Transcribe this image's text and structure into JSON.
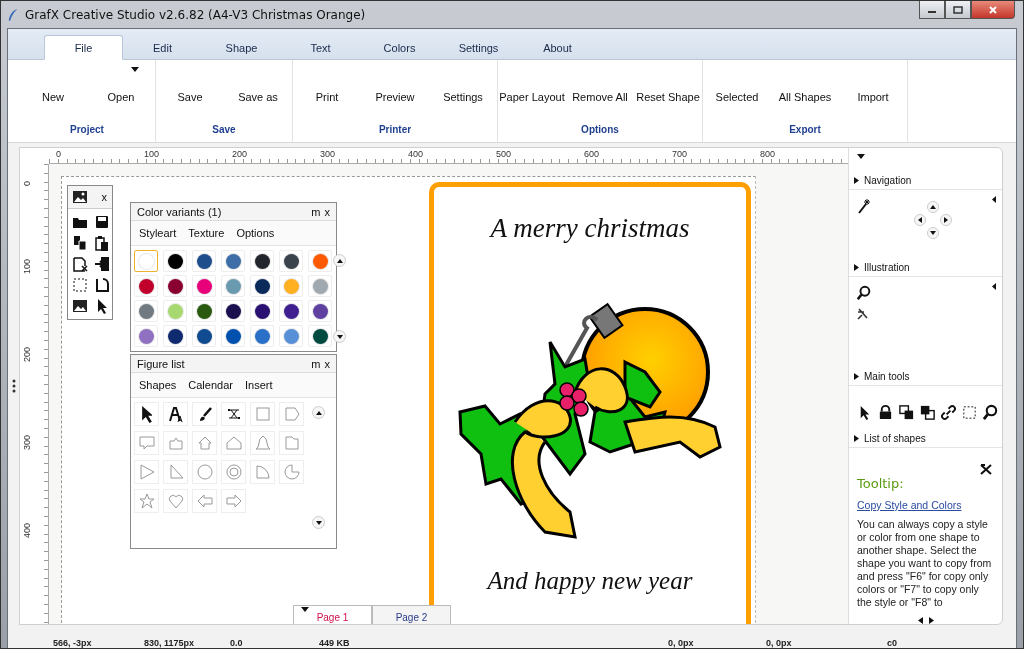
{
  "window": {
    "title": "GrafX Creative Studio v2.6.82 (A4-V3 Christmas Orange)"
  },
  "tabs": [
    {
      "label": "File",
      "selected": true
    },
    {
      "label": "Edit",
      "selected": false
    },
    {
      "label": "Shape",
      "selected": false
    },
    {
      "label": "Text",
      "selected": false
    },
    {
      "label": "Colors",
      "selected": false
    },
    {
      "label": "Settings",
      "selected": false
    },
    {
      "label": "About",
      "selected": false
    }
  ],
  "ribbon": {
    "groups": [
      {
        "label": "Project",
        "buttons": [
          {
            "label": "New",
            "has_menu": false
          },
          {
            "label": "Open",
            "has_menu": true
          }
        ]
      },
      {
        "label": "Save",
        "buttons": [
          {
            "label": "Save",
            "has_menu": false
          },
          {
            "label": "Save as",
            "has_menu": false
          }
        ]
      },
      {
        "label": "Printer",
        "buttons": [
          {
            "label": "Print",
            "has_menu": false
          },
          {
            "label": "Preview",
            "has_menu": false
          },
          {
            "label": "Settings",
            "has_menu": false
          }
        ]
      },
      {
        "label": "Options",
        "buttons": [
          {
            "label": "Paper Layout",
            "has_menu": false
          },
          {
            "label": "Remove All",
            "has_menu": false
          },
          {
            "label": "Reset Shape",
            "has_menu": false
          }
        ]
      },
      {
        "label": "Export",
        "buttons": [
          {
            "label": "Selected",
            "has_menu": false
          },
          {
            "label": "All Shapes",
            "has_menu": false
          },
          {
            "label": "Import",
            "has_menu": false
          }
        ]
      }
    ]
  },
  "rulers": {
    "horizontal": [
      "0",
      "100",
      "200",
      "300",
      "400",
      "500",
      "600",
      "700",
      "800"
    ],
    "vertical": [
      "0",
      "100",
      "200",
      "300",
      "400"
    ]
  },
  "toolbox": {
    "close": "x"
  },
  "color_panel": {
    "title": "Color variants (1)",
    "controls": [
      "m",
      "x"
    ],
    "tabs": [
      "Styleart",
      "Texture",
      "Options"
    ],
    "swatches": [
      {
        "color": "#ffffff",
        "selected": true
      },
      {
        "color": "#000000",
        "selected": false
      },
      {
        "color": "#1e4e8c",
        "selected": false
      },
      {
        "color": "#3d6ea8",
        "selected": false
      },
      {
        "color": "#22262c",
        "selected": false
      },
      {
        "color": "#3a424c",
        "selected": false
      },
      {
        "color": "#ff5a00",
        "selected": false
      },
      {
        "color": "#c0002a",
        "selected": false
      },
      {
        "color": "#8a0030",
        "selected": false
      },
      {
        "color": "#e8007a",
        "selected": false
      },
      {
        "color": "#6a9ab0",
        "selected": false
      },
      {
        "color": "#0a2a5a",
        "selected": false
      },
      {
        "color": "#ffb020",
        "selected": false
      },
      {
        "color": "#a0a8b0",
        "selected": false
      },
      {
        "color": "#707a80",
        "selected": false
      },
      {
        "color": "#a8d870",
        "selected": false
      },
      {
        "color": "#2a5a10",
        "selected": false
      },
      {
        "color": "#1a1050",
        "selected": false
      },
      {
        "color": "#2a1070",
        "selected": false
      },
      {
        "color": "#402090",
        "selected": false
      },
      {
        "color": "#6040a0",
        "selected": false
      },
      {
        "color": "#9070c0",
        "selected": false
      },
      {
        "color": "#102a70",
        "selected": false
      },
      {
        "color": "#104a90",
        "selected": false
      },
      {
        "color": "#0050b0",
        "selected": false
      },
      {
        "color": "#2a70c8",
        "selected": false
      },
      {
        "color": "#5890d8",
        "selected": false
      },
      {
        "color": "#004a40",
        "selected": false
      }
    ]
  },
  "figure_panel": {
    "title": "Figure list",
    "controls": [
      "m",
      "x"
    ],
    "tabs": [
      "Shapes",
      "Calendar",
      "Insert"
    ]
  },
  "card": {
    "heading": "A merry christmas",
    "footer": "And happy new year"
  },
  "page_tabs": [
    {
      "label": "Page 1",
      "selected": true
    },
    {
      "label": "Page 2",
      "selected": false
    }
  ],
  "side_panel": {
    "sections": [
      {
        "title": "Navigation"
      },
      {
        "title": "Illustration"
      },
      {
        "title": "Main tools"
      },
      {
        "title": "List of shapes"
      }
    ],
    "tooltip": {
      "title": "Tooltip:",
      "link": "Copy Style and Colors",
      "text": "You can always copy a style or color from one shape to another shape. Select the shape you want to copy from and press \"F6\" for copy only colors or \"F7\" to copy only the style or \"F8\" to"
    }
  },
  "status_bar": {
    "fields": [
      "566, -3px",
      "830, 1175px",
      "0.0",
      "449 KB",
      "0, 0px",
      "0, 0px",
      "c0"
    ]
  }
}
